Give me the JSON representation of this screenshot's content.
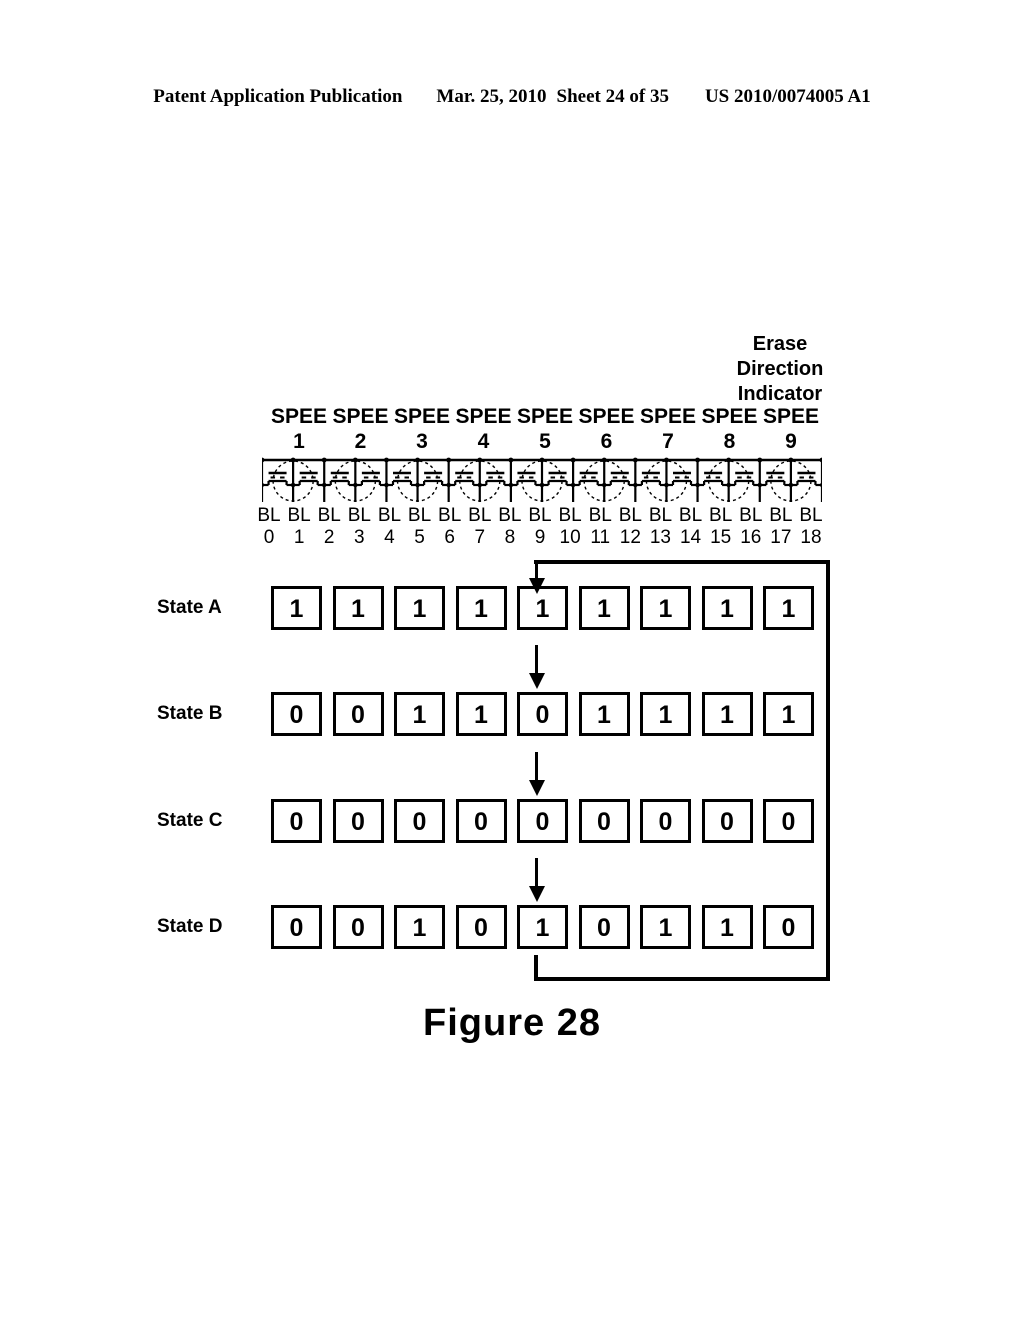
{
  "header": {
    "publication": "Patent Application Publication",
    "date": "Mar. 25, 2010",
    "sheet": "Sheet 24 of 35",
    "docnum": "US 2010/0074005 A1"
  },
  "figure": {
    "caption": "Figure 28",
    "erase_indicator": {
      "line1": "Erase",
      "line2": "Direction",
      "line3": "Indicator"
    },
    "spee_labels": [
      "SPEE",
      "SPEE",
      "SPEE",
      "SPEE",
      "SPEE",
      "SPEE",
      "SPEE",
      "SPEE",
      "SPEE"
    ],
    "spee_numbers": [
      "1",
      "2",
      "3",
      "4",
      "5",
      "6",
      "7",
      "8",
      "9"
    ],
    "bitlines": [
      {
        "name": "BL",
        "index": "0"
      },
      {
        "name": "BL",
        "index": "1"
      },
      {
        "name": "BL",
        "index": "2"
      },
      {
        "name": "BL",
        "index": "3"
      },
      {
        "name": "BL",
        "index": "4"
      },
      {
        "name": "BL",
        "index": "5"
      },
      {
        "name": "BL",
        "index": "6"
      },
      {
        "name": "BL",
        "index": "7"
      },
      {
        "name": "BL",
        "index": "8"
      },
      {
        "name": "BL",
        "index": "9"
      },
      {
        "name": "BL",
        "index": "10"
      },
      {
        "name": "BL",
        "index": "11"
      },
      {
        "name": "BL",
        "index": "12"
      },
      {
        "name": "BL",
        "index": "13"
      },
      {
        "name": "BL",
        "index": "14"
      },
      {
        "name": "BL",
        "index": "15"
      },
      {
        "name": "BL",
        "index": "16"
      },
      {
        "name": "BL",
        "index": "17"
      },
      {
        "name": "BL",
        "index": "18"
      }
    ],
    "states": [
      {
        "label": "State A",
        "bits": [
          "1",
          "1",
          "1",
          "1",
          "1",
          "1",
          "1",
          "1",
          "1"
        ]
      },
      {
        "label": "State B",
        "bits": [
          "0",
          "0",
          "1",
          "1",
          "0",
          "1",
          "1",
          "1",
          "1"
        ]
      },
      {
        "label": "State C",
        "bits": [
          "0",
          "0",
          "0",
          "0",
          "0",
          "0",
          "0",
          "0",
          "0"
        ]
      },
      {
        "label": "State D",
        "bits": [
          "0",
          "0",
          "1",
          "0",
          "1",
          "0",
          "1",
          "1",
          "0"
        ]
      }
    ],
    "colors": {
      "ink": "#000000",
      "paper": "#ffffff"
    }
  }
}
